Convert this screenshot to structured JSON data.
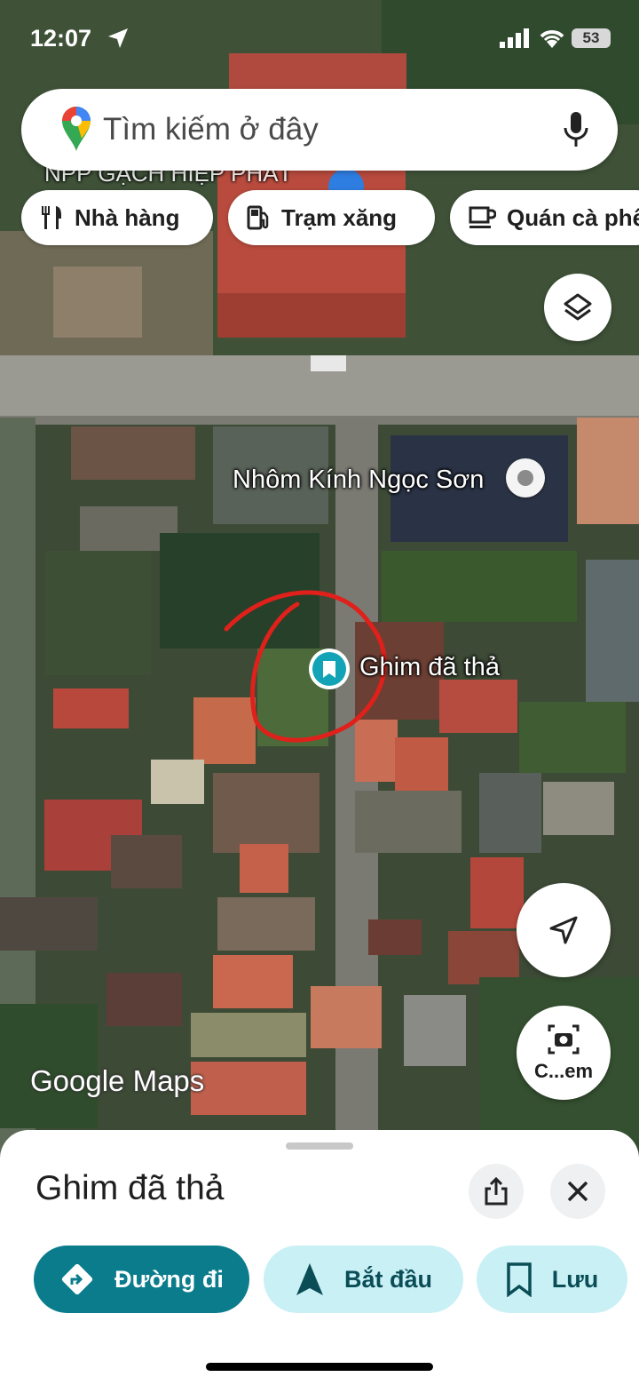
{
  "status_bar": {
    "time": "12:07",
    "battery": "53"
  },
  "search": {
    "placeholder": "Tìm kiếm ở đây"
  },
  "chips": [
    {
      "label": "Nhà hàng",
      "icon": "restaurant-icon"
    },
    {
      "label": "Trạm xăng",
      "icon": "gas-station-icon"
    },
    {
      "label": "Quán cà phê",
      "icon": "coffee-icon"
    }
  ],
  "map": {
    "shop_label": "NPP GẠCH HIỆP PHÁT",
    "place_label": "Nhôm Kính Ngọc Sơn",
    "pin_label": "Ghim đã thả",
    "watermark_google": "Google",
    "watermark_maps": "Maps"
  },
  "lens_button": {
    "label": "C...em"
  },
  "sheet": {
    "title": "Ghim đã thả",
    "actions": [
      {
        "label": "Đường đi"
      },
      {
        "label": "Bắt đầu"
      },
      {
        "label": "Lưu"
      }
    ]
  },
  "colors": {
    "primary": "#0a7c8c",
    "tonal": "#c9f0f5",
    "annotation": "#e0201a"
  }
}
